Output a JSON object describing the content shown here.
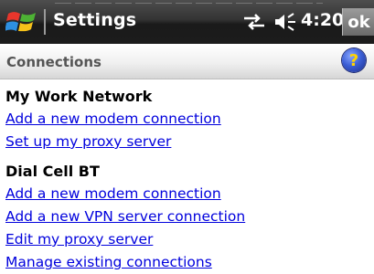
{
  "titlebar": {
    "app_title": "Settings",
    "clock": "4:20",
    "ok_label": "ok"
  },
  "header": {
    "title": "Connections"
  },
  "sections": [
    {
      "heading": "My Work Network",
      "links": [
        "Add a new modem connection",
        "Set up my proxy server"
      ]
    },
    {
      "heading": "Dial Cell BT",
      "links": [
        "Add a new modem connection",
        "Add a new VPN server connection",
        "Edit my proxy server",
        "Manage existing connections"
      ]
    }
  ],
  "colors": {
    "link": "#0000dd",
    "header_text": "#555555",
    "titlebar": "#2a2a2a"
  },
  "icons": [
    "start-logo-icon",
    "connectivity-icon",
    "volume-icon",
    "help-icon"
  ]
}
